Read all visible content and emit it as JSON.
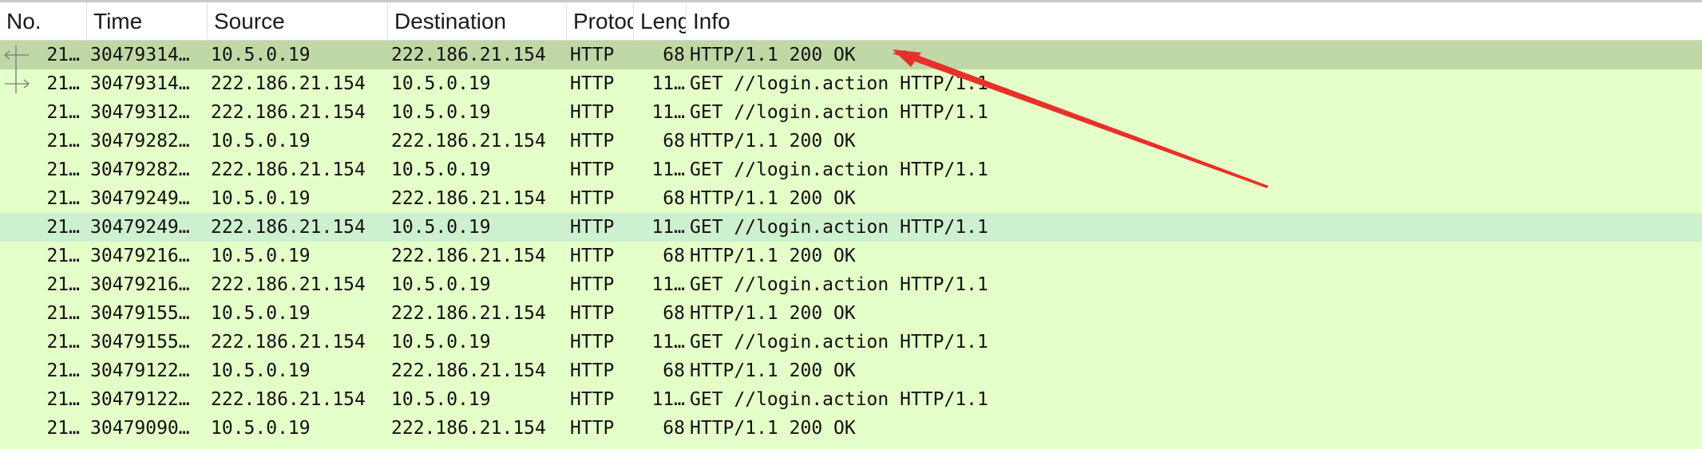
{
  "columns": {
    "no": "No.",
    "time": "Time",
    "source": "Source",
    "destination": "Destination",
    "protocol": "Protocol",
    "length": "Length",
    "info": "Info"
  },
  "packets": [
    {
      "no": "21…",
      "time": "30479314…",
      "source": "10.5.0.19",
      "destination": "222.186.21.154",
      "protocol": "HTTP",
      "length": "68",
      "info": "HTTP/1.1 200 OK"
    },
    {
      "no": "21…",
      "time": "30479314…",
      "source": "222.186.21.154",
      "destination": "10.5.0.19",
      "protocol": "HTTP",
      "length": "11…",
      "info": "GET //login.action HTTP/1.1"
    },
    {
      "no": "21…",
      "time": "30479312…",
      "source": "222.186.21.154",
      "destination": "10.5.0.19",
      "protocol": "HTTP",
      "length": "11…",
      "info": "GET //login.action HTTP/1.1"
    },
    {
      "no": "21…",
      "time": "30479282…",
      "source": "10.5.0.19",
      "destination": "222.186.21.154",
      "protocol": "HTTP",
      "length": "68",
      "info": "HTTP/1.1 200 OK"
    },
    {
      "no": "21…",
      "time": "30479282…",
      "source": "222.186.21.154",
      "destination": "10.5.0.19",
      "protocol": "HTTP",
      "length": "11…",
      "info": "GET //login.action HTTP/1.1"
    },
    {
      "no": "21…",
      "time": "30479249…",
      "source": "10.5.0.19",
      "destination": "222.186.21.154",
      "protocol": "HTTP",
      "length": "68",
      "info": "HTTP/1.1 200 OK"
    },
    {
      "no": "21…",
      "time": "30479249…",
      "source": "222.186.21.154",
      "destination": "10.5.0.19",
      "protocol": "HTTP",
      "length": "11…",
      "info": "GET //login.action HTTP/1.1"
    },
    {
      "no": "21…",
      "time": "30479216…",
      "source": "10.5.0.19",
      "destination": "222.186.21.154",
      "protocol": "HTTP",
      "length": "68",
      "info": "HTTP/1.1 200 OK"
    },
    {
      "no": "21…",
      "time": "30479216…",
      "source": "222.186.21.154",
      "destination": "10.5.0.19",
      "protocol": "HTTP",
      "length": "11…",
      "info": "GET //login.action HTTP/1.1"
    },
    {
      "no": "21…",
      "time": "30479155…",
      "source": "10.5.0.19",
      "destination": "222.186.21.154",
      "protocol": "HTTP",
      "length": "68",
      "info": "HTTP/1.1 200 OK"
    },
    {
      "no": "21…",
      "time": "30479155…",
      "source": "222.186.21.154",
      "destination": "10.5.0.19",
      "protocol": "HTTP",
      "length": "11…",
      "info": "GET //login.action HTTP/1.1"
    },
    {
      "no": "21…",
      "time": "30479122…",
      "source": "10.5.0.19",
      "destination": "222.186.21.154",
      "protocol": "HTTP",
      "length": "68",
      "info": "HTTP/1.1 200 OK"
    },
    {
      "no": "21…",
      "time": "30479122…",
      "source": "222.186.21.154",
      "destination": "10.5.0.19",
      "protocol": "HTTP",
      "length": "11…",
      "info": "GET //login.action HTTP/1.1"
    },
    {
      "no": "21…",
      "time": "30479090…",
      "source": "10.5.0.19",
      "destination": "222.186.21.154",
      "protocol": "HTTP",
      "length": "68",
      "info": "HTTP/1.1 200 OK"
    },
    {
      "no": "",
      "time": "",
      "source": "",
      "destination": "",
      "protocol": "",
      "length": "",
      "info": ""
    }
  ],
  "colors": {
    "row_background": "#e4ffc7",
    "selected_row": "#c0d8a5",
    "hover_row": "#cdf0cf",
    "annotation_arrow": "#e8302a"
  },
  "icons": {
    "sort": "sort-descending-icon",
    "response": "related-response-icon",
    "request": "related-request-icon"
  }
}
